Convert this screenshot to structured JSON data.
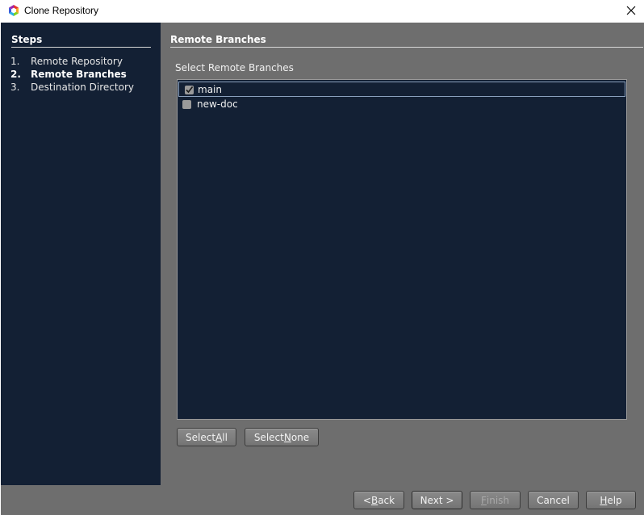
{
  "window": {
    "title": "Clone Repository"
  },
  "steps": {
    "heading": "Steps",
    "items": [
      {
        "num": "1.",
        "label": "Remote Repository"
      },
      {
        "num": "2.",
        "label": "Remote Branches"
      },
      {
        "num": "3.",
        "label": "Destination Directory"
      }
    ],
    "current_index": 1
  },
  "panel": {
    "title": "Remote Branches",
    "list_label": "Select Remote Branches",
    "branches": [
      {
        "name": "main",
        "checked": true,
        "selected": true
      },
      {
        "name": "new-doc",
        "checked": false,
        "selected": false
      }
    ],
    "select_all": {
      "pre": "Select ",
      "mnemonic": "A",
      "post": "ll"
    },
    "select_none": {
      "pre": "Select ",
      "mnemonic": "N",
      "post": "one"
    }
  },
  "footer": {
    "back": {
      "pre": "< ",
      "mnemonic": "B",
      "post": "ack"
    },
    "next": "Next >",
    "finish": {
      "mnemonic": "F",
      "post": "inish"
    },
    "cancel": "Cancel",
    "help": {
      "mnemonic": "H",
      "post": "elp"
    }
  },
  "colors": {
    "panel_bg": "#132034",
    "content_bg": "#6e6e6e",
    "button_bg": "#7d7d7d"
  }
}
